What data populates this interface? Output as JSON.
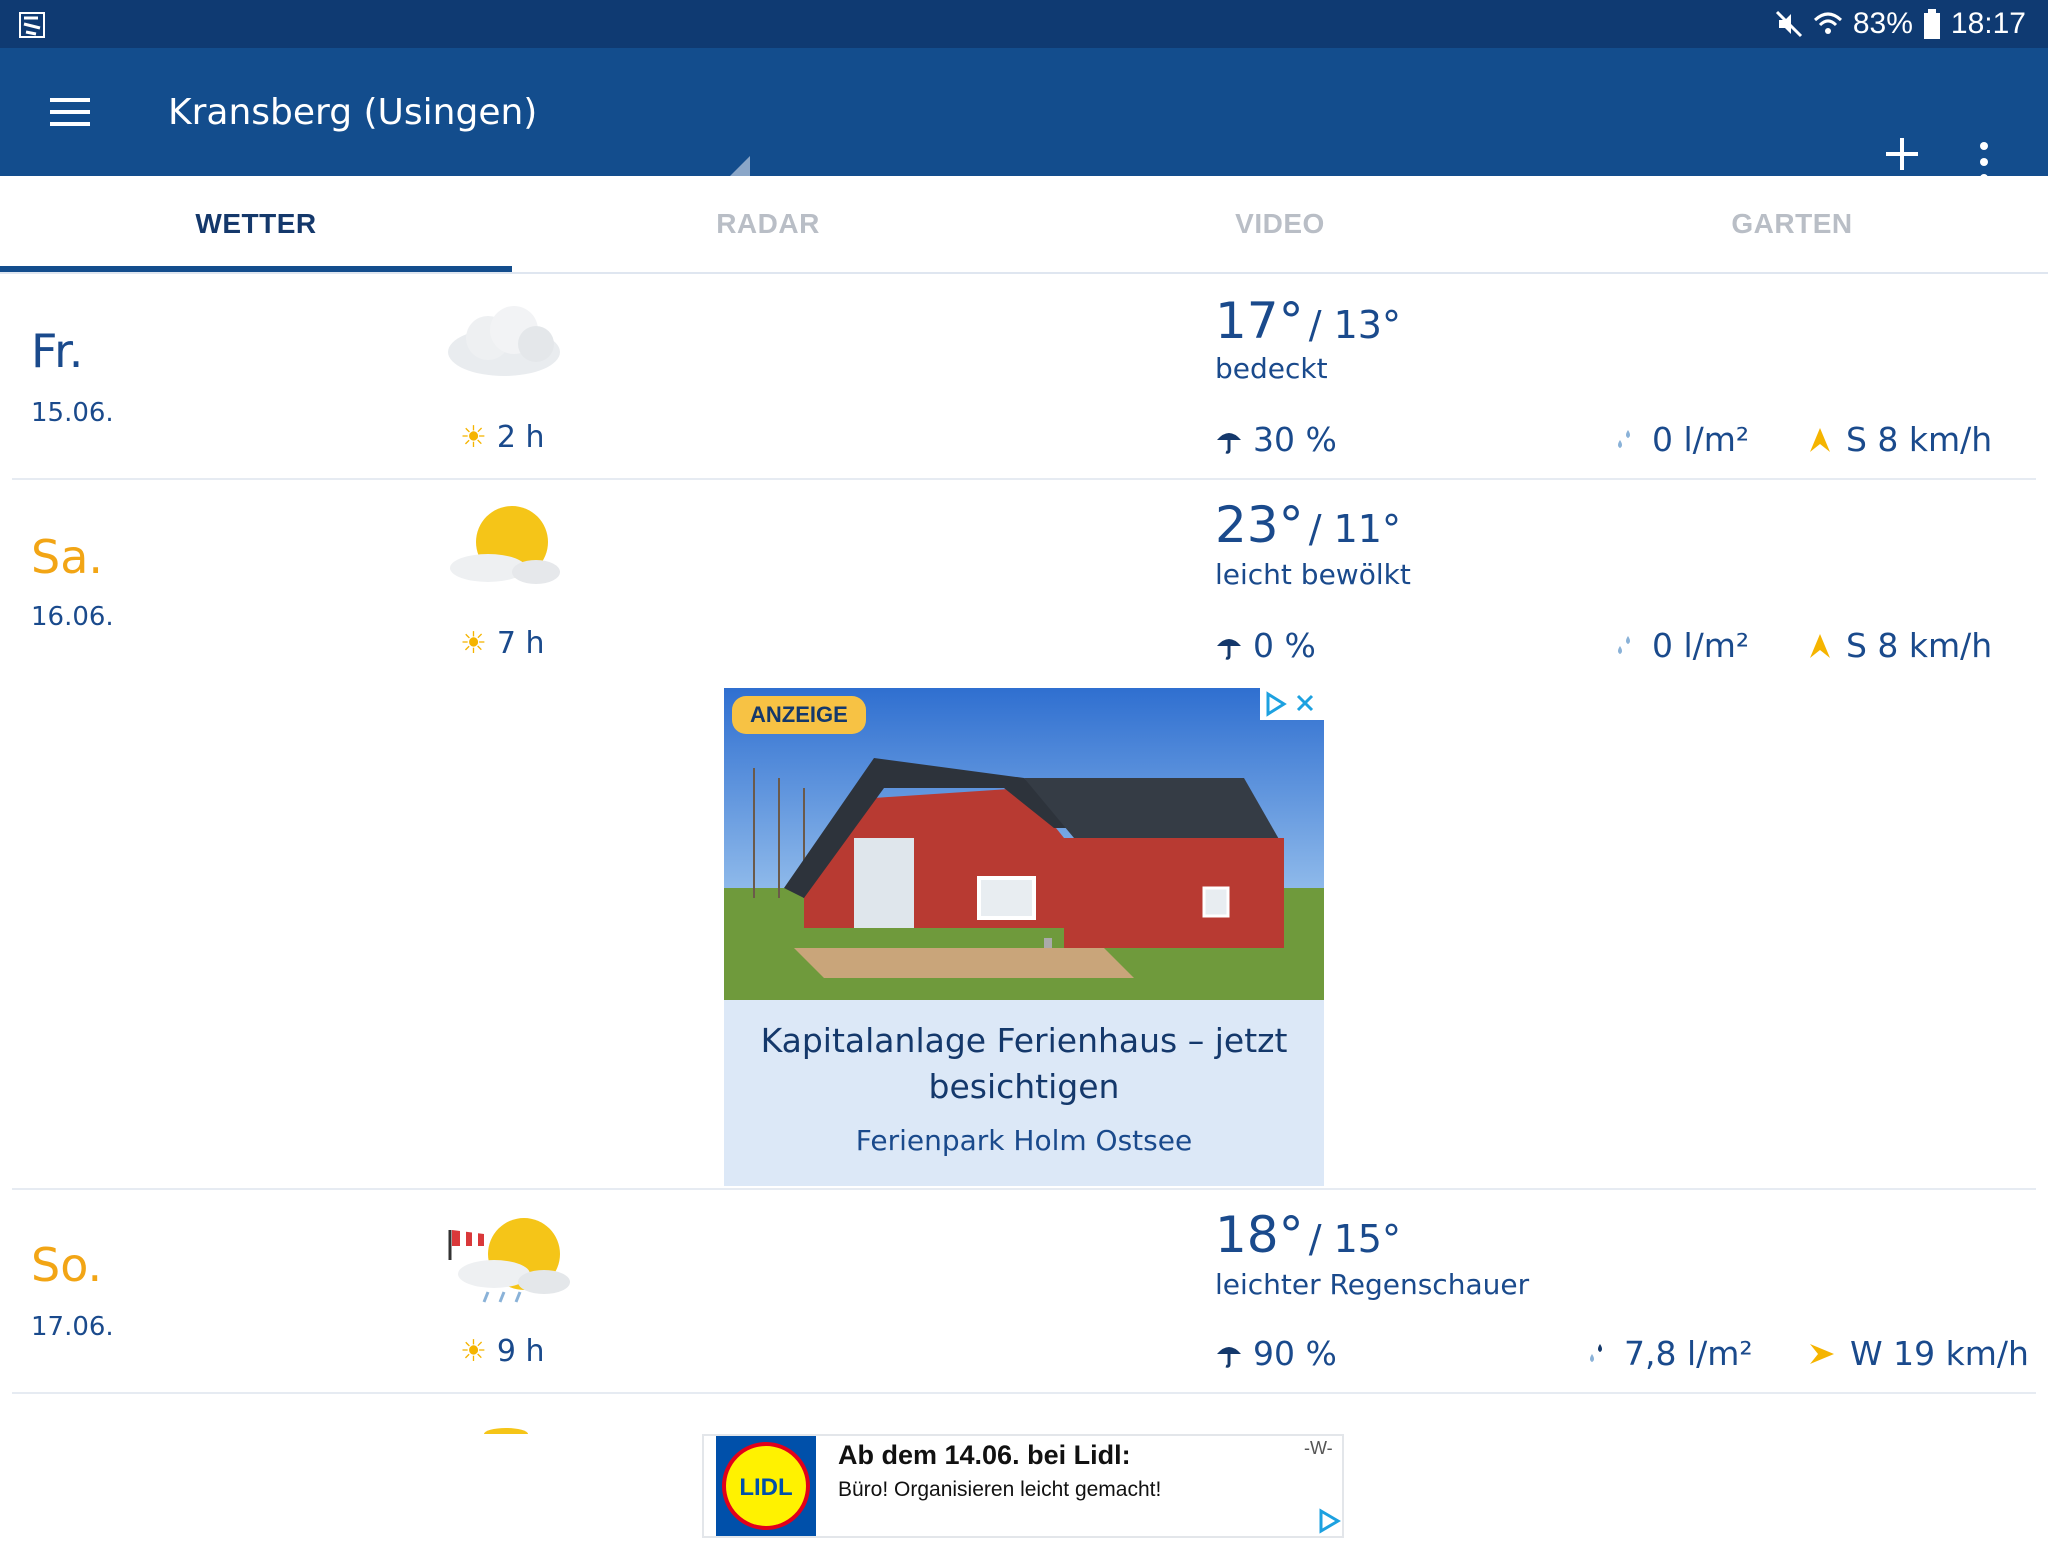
{
  "status_bar": {
    "battery": "83%",
    "time": "18:17"
  },
  "app_bar": {
    "location": "Kransberg (Usingen)"
  },
  "tabs": [
    {
      "label": "WETTER",
      "active": true
    },
    {
      "label": "RADAR",
      "active": false
    },
    {
      "label": "VIDEO",
      "active": false
    },
    {
      "label": "GARTEN",
      "active": false
    }
  ],
  "forecast": [
    {
      "day": "Fr.",
      "date": "15.06.",
      "day_color": "#1a4a8c",
      "sun": "2 h",
      "hi": "17°",
      "lo": "/ 13°",
      "condition": "bedeckt",
      "precip_prob": "30 %",
      "rain": "0 l/m²",
      "wind": "S 8 km/h",
      "icon": "overcast-cloud-icon"
    },
    {
      "day": "Sa.",
      "date": "16.06.",
      "day_color": "#f2a515",
      "sun": "7 h",
      "hi": "23°",
      "lo": "/ 11°",
      "condition": "leicht bewölkt",
      "precip_prob": "0 %",
      "rain": "0 l/m²",
      "wind": "S 8 km/h",
      "icon": "sun-cloud-icon"
    },
    {
      "day": "So.",
      "date": "17.06.",
      "day_color": "#f2a515",
      "sun": "9 h",
      "hi": "18°",
      "lo": "/ 15°",
      "condition": "leichter Regenschauer",
      "precip_prob": "90 %",
      "rain": "7,8 l/m²",
      "wind": "W 19 km/h",
      "icon": "sun-rain-wind-icon"
    }
  ],
  "ad_main": {
    "badge": "ANZEIGE",
    "headline": "Kapitalanlage Ferienhaus – jetzt besichtigen",
    "sponsor": "Ferienpark Holm Ostsee"
  },
  "ad_bottom": {
    "title": "Ab dem 14.06. bei Lidl:",
    "text": "Büro! Organisieren leicht gemacht!",
    "mark": "-W-",
    "logo_text": "LIDL"
  }
}
